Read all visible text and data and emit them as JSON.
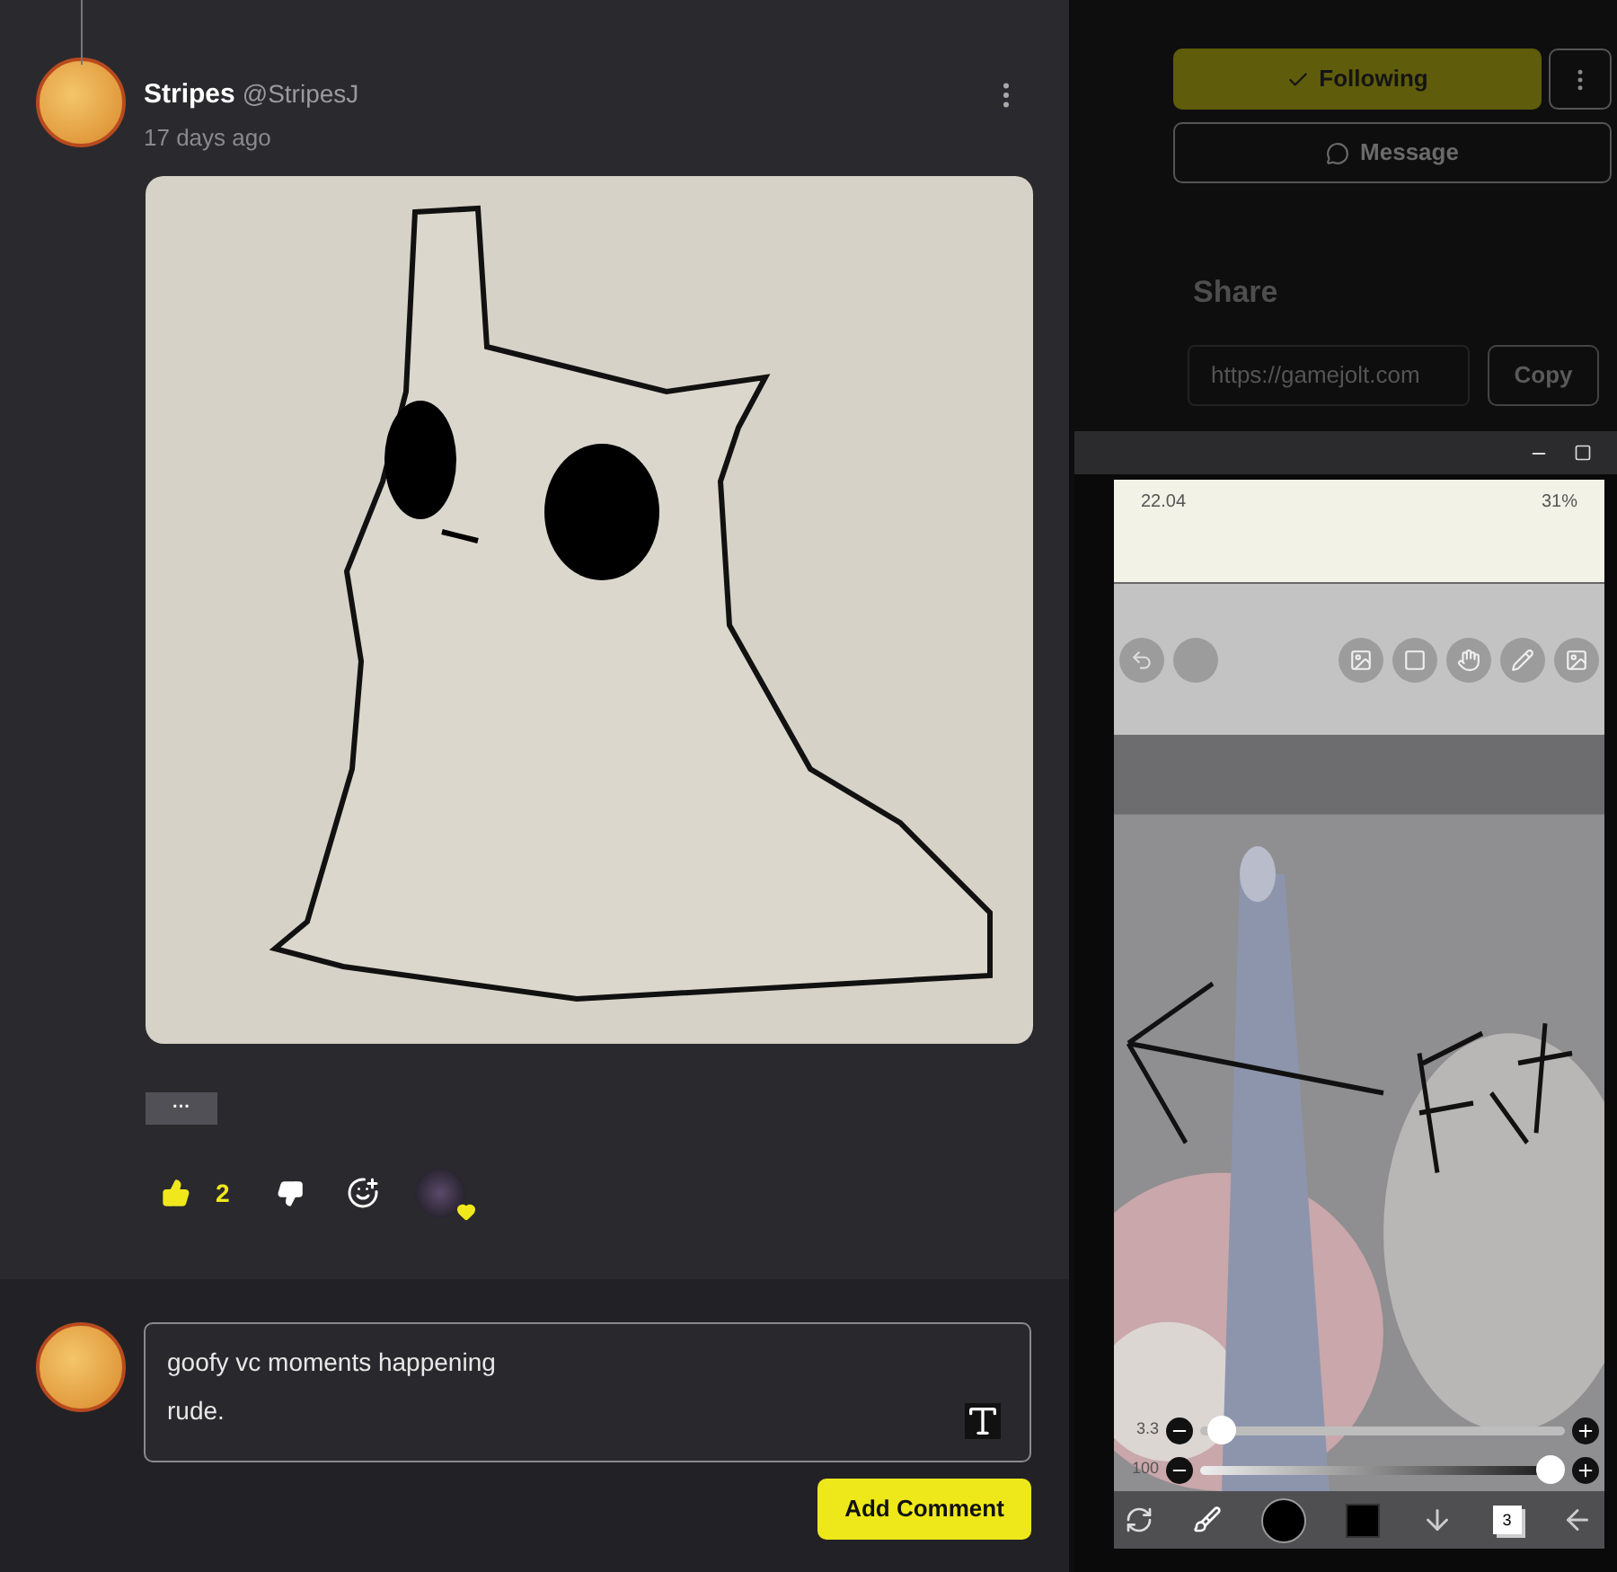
{
  "post": {
    "author": "Stripes",
    "handle": "@StripesJ",
    "time": "17 days ago",
    "tag": "···",
    "likes": "2",
    "liked": true
  },
  "comment_box": {
    "lines": [
      "goofy vc moments happening",
      "rude."
    ],
    "button": "Add Comment"
  },
  "profile": {
    "following_label": "Following",
    "following": true,
    "message_label": "Message",
    "share_title": "Share",
    "share_url": "https://gamejolt.com",
    "copy_label": "Copy"
  },
  "phone": {
    "time": "22.04",
    "battery": "31%",
    "sliders": [
      {
        "reading": "3.3",
        "level": 0.02
      },
      {
        "reading": "100",
        "level": 1
      }
    ],
    "layers": "3"
  }
}
